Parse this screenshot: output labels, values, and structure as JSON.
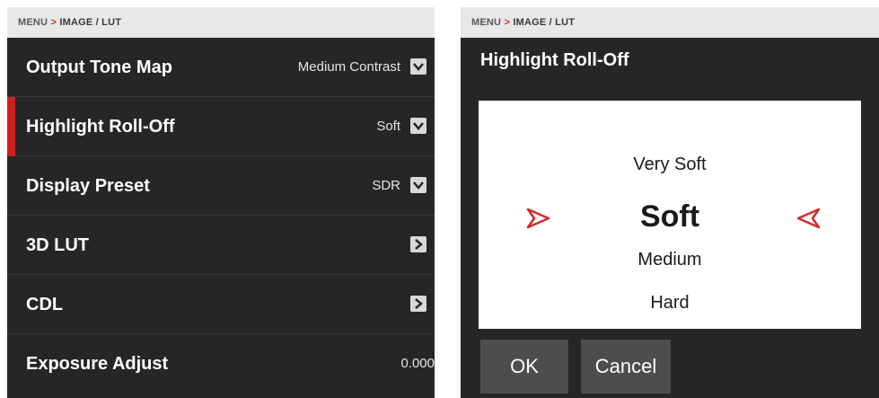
{
  "breadcrumb": {
    "menu": "MENU",
    "separator": ">",
    "path": "IMAGE / LUT"
  },
  "menu": {
    "rows": [
      {
        "label": "Output Tone Map",
        "value": "Medium Contrast",
        "control": "dropdown"
      },
      {
        "label": "Highlight Roll-Off",
        "value": "Soft",
        "control": "dropdown",
        "selected": true
      },
      {
        "label": "Display Preset",
        "value": "SDR",
        "control": "dropdown"
      },
      {
        "label": "3D LUT",
        "value": "",
        "control": "submenu"
      },
      {
        "label": "CDL",
        "value": "",
        "control": "submenu"
      },
      {
        "label": "Exposure Adjust",
        "value": "0.000",
        "control": "value"
      }
    ]
  },
  "dialog": {
    "title": "Highlight Roll-Off",
    "options": [
      "Very Soft",
      "Soft",
      "Medium",
      "Hard"
    ],
    "selected": "Soft",
    "ok_label": "OK",
    "cancel_label": "Cancel"
  },
  "colors": {
    "accent": "#cc1f1f",
    "panel_bg": "#262626",
    "crumb_bg": "#e8e8e8"
  },
  "icons": {
    "dropdown": "chevron-down-icon",
    "submenu": "chevron-right-icon",
    "picker_arrows": "selection-arrow-icon"
  }
}
